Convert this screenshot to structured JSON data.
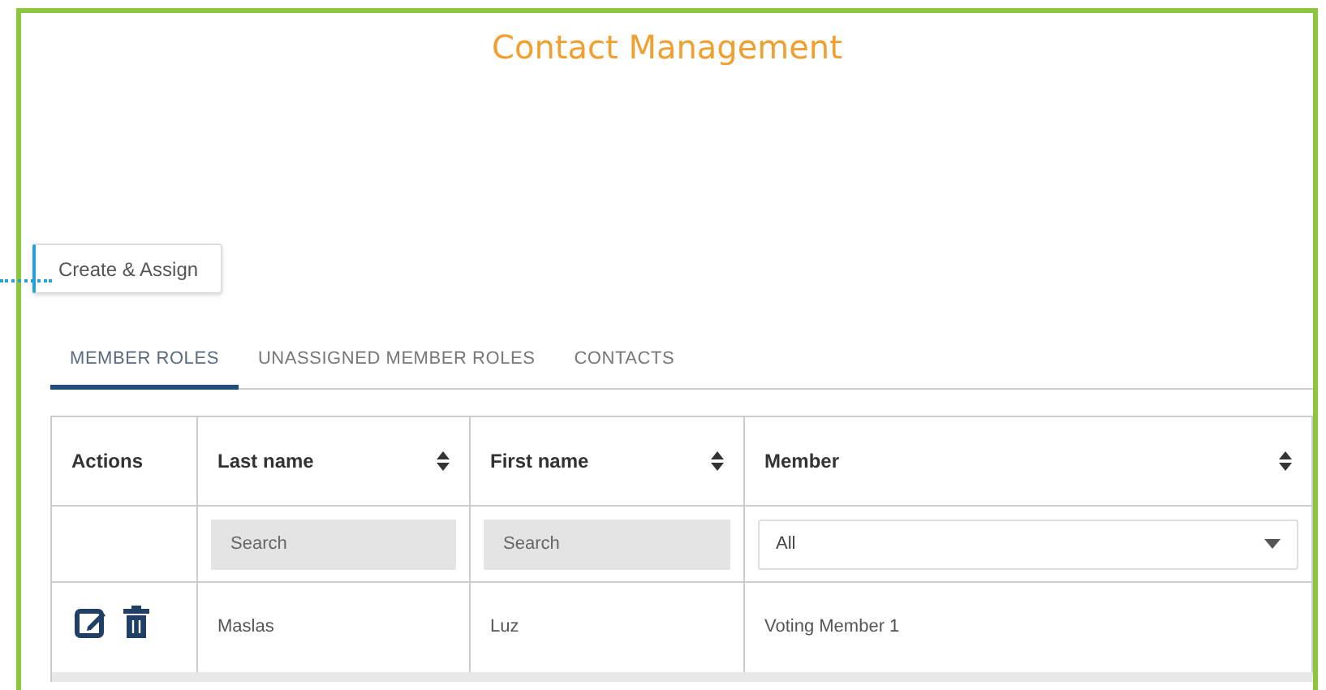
{
  "title": "Contact Management",
  "create_button": "Create & Assign",
  "tabs": [
    {
      "label": "MEMBER ROLES",
      "selected": true
    },
    {
      "label": "UNASSIGNED MEMBER ROLES",
      "selected": false
    },
    {
      "label": "CONTACTS",
      "selected": false
    }
  ],
  "table": {
    "columns": [
      {
        "label": "Actions",
        "sortable": false
      },
      {
        "label": "Last name",
        "sortable": true,
        "filter": {
          "kind": "search",
          "placeholder": "Search"
        }
      },
      {
        "label": "First name",
        "sortable": true,
        "filter": {
          "kind": "search",
          "placeholder": "Search"
        }
      },
      {
        "label": "Member",
        "sortable": true,
        "filter": {
          "kind": "select",
          "value": "All"
        }
      }
    ],
    "rows": [
      {
        "last_name": "Maslas",
        "first_name": "Luz",
        "member": "Voting Member 1"
      }
    ]
  }
}
